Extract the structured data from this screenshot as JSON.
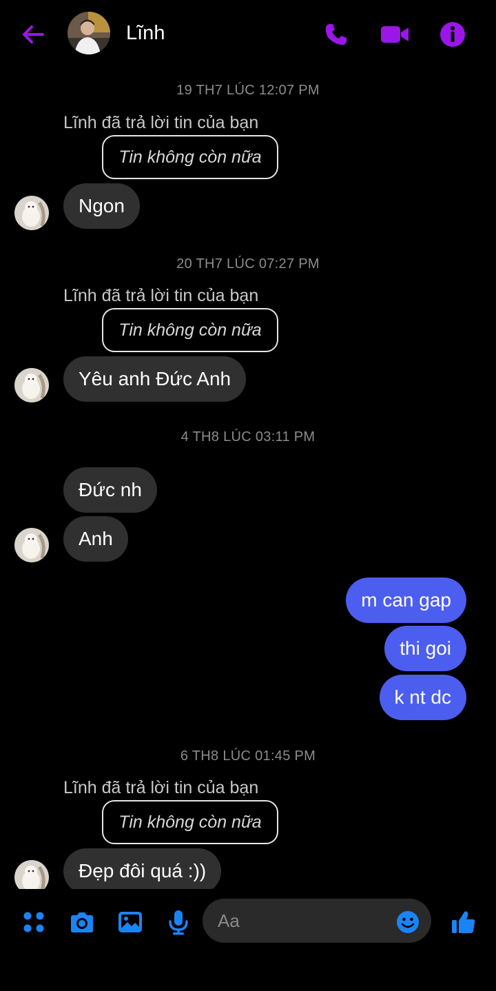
{
  "header": {
    "contact_name": "Lĩnh",
    "back_icon": "arrow-left-icon",
    "call_icon": "phone-icon",
    "video_icon": "video-camera-icon",
    "info_icon": "info-icon",
    "accent_color": "#9b16e8"
  },
  "messages": [
    {
      "kind": "timestamp",
      "text": "19 TH7 LÚC 12:07 PM"
    },
    {
      "kind": "reply_note",
      "text": "Lĩnh đã trả lời tin của bạn"
    },
    {
      "kind": "reply_quote",
      "text": "Tin không còn nữa"
    },
    {
      "kind": "incoming",
      "text": "Ngon"
    },
    {
      "kind": "timestamp",
      "text": "20 TH7 LÚC 07:27 PM"
    },
    {
      "kind": "reply_note",
      "text": "Lĩnh đã trả lời tin của bạn"
    },
    {
      "kind": "reply_quote",
      "text": "Tin không còn nữa"
    },
    {
      "kind": "incoming",
      "text": "Yêu anh Đức Anh"
    },
    {
      "kind": "timestamp",
      "text": "4 TH8 LÚC 03:11 PM"
    },
    {
      "kind": "incoming",
      "text": "Đức nh"
    },
    {
      "kind": "incoming",
      "text": "Anh"
    },
    {
      "kind": "outgoing",
      "text": "m can gap"
    },
    {
      "kind": "outgoing",
      "text": "thi goi"
    },
    {
      "kind": "outgoing",
      "text": "k nt dc"
    },
    {
      "kind": "timestamp",
      "text": "6 TH8 LÚC 01:45 PM"
    },
    {
      "kind": "reply_note",
      "text": "Lĩnh đã trả lời tin của bạn"
    },
    {
      "kind": "reply_quote",
      "text": "Tin không còn nữa"
    },
    {
      "kind": "incoming",
      "text": "Đẹp đôi quá :))"
    }
  ],
  "composer": {
    "placeholder": "Aa",
    "icons": [
      "apps-menu-icon",
      "camera-icon",
      "gallery-icon",
      "microphone-icon",
      "emoji-icon",
      "thumbs-up-icon"
    ],
    "accent_color": "#1b84f5"
  },
  "colors": {
    "outgoing_bubble": "#4c5ef0",
    "incoming_bubble": "#303030",
    "background": "#000000"
  }
}
